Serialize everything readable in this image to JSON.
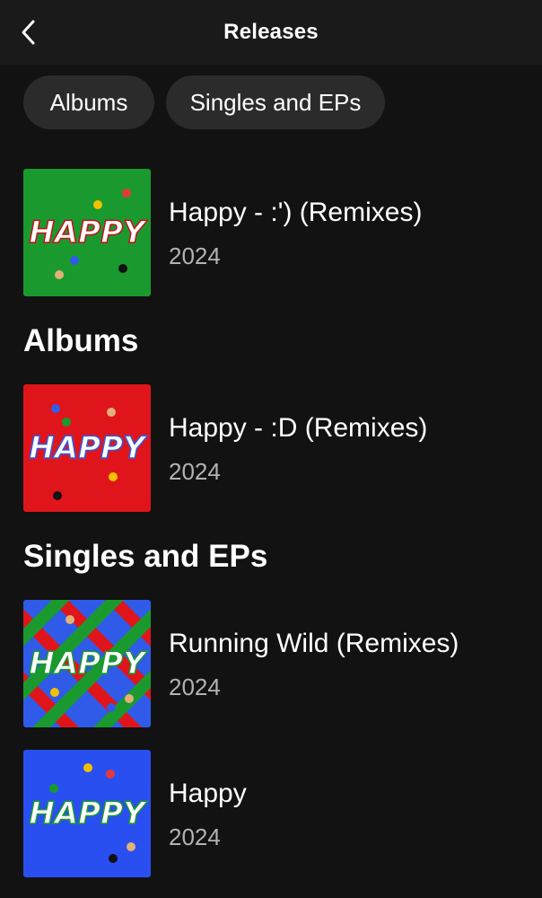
{
  "header": {
    "title": "Releases",
    "back_icon": "chevron-left-icon"
  },
  "filters": [
    {
      "label": "Albums"
    },
    {
      "label": "Singles and EPs"
    }
  ],
  "featured": {
    "name": "Happy - :') (Remixes)",
    "year": "2024",
    "cover_text": "HAPPY",
    "cover_color": "#1a9a2e"
  },
  "sections": [
    {
      "title": "Albums",
      "items": [
        {
          "name": "Happy - :D (Remixes)",
          "year": "2024",
          "cover_text": "HAPPY",
          "cover_color": "#e0151b"
        }
      ]
    },
    {
      "title": "Singles and EPs",
      "items": [
        {
          "name": "Running Wild (Remixes)",
          "year": "2024",
          "cover_text": "HAPPY",
          "cover_color": "#2f5be8"
        },
        {
          "name": "Happy",
          "year": "2024",
          "cover_text": "HAPPY",
          "cover_color": "#2a4ff0"
        }
      ]
    }
  ]
}
